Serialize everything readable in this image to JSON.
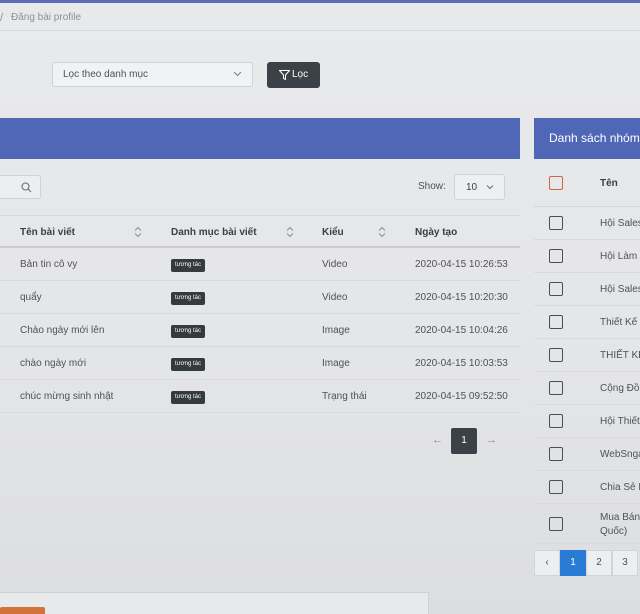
{
  "breadcrumb": {
    "separator": "/",
    "current": "Đăng bài profile"
  },
  "filter": {
    "category_placeholder": "Lọc theo danh mục",
    "button_label": "Lọc"
  },
  "posts_table": {
    "show_label": "Show:",
    "show_value": "10",
    "columns": [
      "Tên bài viết",
      "Danh mục bài viết",
      "Kiểu",
      "Ngày tạo"
    ],
    "rows": [
      {
        "name": "Bản tin cô vy",
        "category": "tương tác",
        "type": "Video",
        "date": "2020-04-15 10:26:53"
      },
      {
        "name": "quẩy",
        "category": "tương tác",
        "type": "Video",
        "date": "2020-04-15 10:20:30"
      },
      {
        "name": "Chào ngày mới lên",
        "category": "tương tác",
        "type": "Image",
        "date": "2020-04-15 10:04:26"
      },
      {
        "name": "chào ngày mới",
        "category": "tương tác",
        "type": "Image",
        "date": "2020-04-15 10:03:53"
      },
      {
        "name": "chúc mừng sinh nhật",
        "category": "tương tác",
        "type": "Trạng thái",
        "date": "2020-04-15 09:52:50"
      }
    ],
    "pagination": {
      "prev": "←",
      "current": "1",
      "next": "→"
    }
  },
  "groups_panel": {
    "title": "Danh sách nhóm",
    "column": "Tên",
    "rows": [
      "Hội Sales",
      "Hội Làm",
      "Hội Sales",
      "Thiết Kế",
      "THIẾT KẾ",
      "Cộng Đồn",
      "Hội Thiết",
      "WebSnga",
      "Chia Sẻ K",
      "Mua Bán/ Quốc)"
    ],
    "pagination": {
      "prev": "‹",
      "pages": [
        "1",
        "2",
        "3"
      ]
    }
  },
  "icons": {
    "filter": "filter-icon",
    "search": "search-icon",
    "chevron": "chevron-down-icon",
    "sort": "sort-icon"
  },
  "colors": {
    "header_bar": "#5067b8",
    "dark_button": "#3c4147",
    "tag": "#353a3f",
    "active_page": "#2a7bd6",
    "checkbox_head": "#d0634a"
  }
}
